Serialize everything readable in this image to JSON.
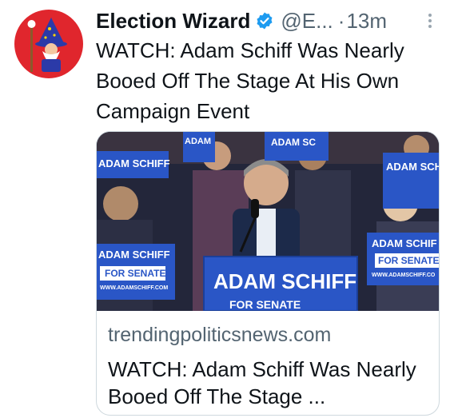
{
  "author": {
    "display_name": "Election Wizard",
    "handle": "@E...",
    "separator": "·",
    "timestamp": "13m",
    "verified": true,
    "avatar_icon": "wizard-icon"
  },
  "tweet": {
    "text": "WATCH: Adam Schiff Was Nearly Booed Off The Stage At His Own Campaign Event"
  },
  "card": {
    "domain": "trendingpoliticsnews.com",
    "title": "WATCH: Adam Schiff Was Nearly Booed Off The Stage ...",
    "image_signs": {
      "main_line1": "ADAM SCHIFF",
      "main_line2": "FOR SENATE",
      "side_line1": "ADAM SCHIFF",
      "side_line2": "FOR SENATE",
      "side_url": "WWW.ADAMSCHIFF.COM",
      "right_line1": "ADAM SCHIF",
      "right_line2": "FOR SENATE",
      "right_url": "WWW.ADAMSCHIFF.CO",
      "top_a": "ADAM SCHIFF",
      "top_b": "ADAM SC",
      "top_c": "ADAM SCH",
      "top_d": "ADAM"
    }
  },
  "colors": {
    "verified_blue": "#1d9bf0",
    "avatar_red": "#e0262d",
    "sign_blue": "#2a56c6"
  }
}
